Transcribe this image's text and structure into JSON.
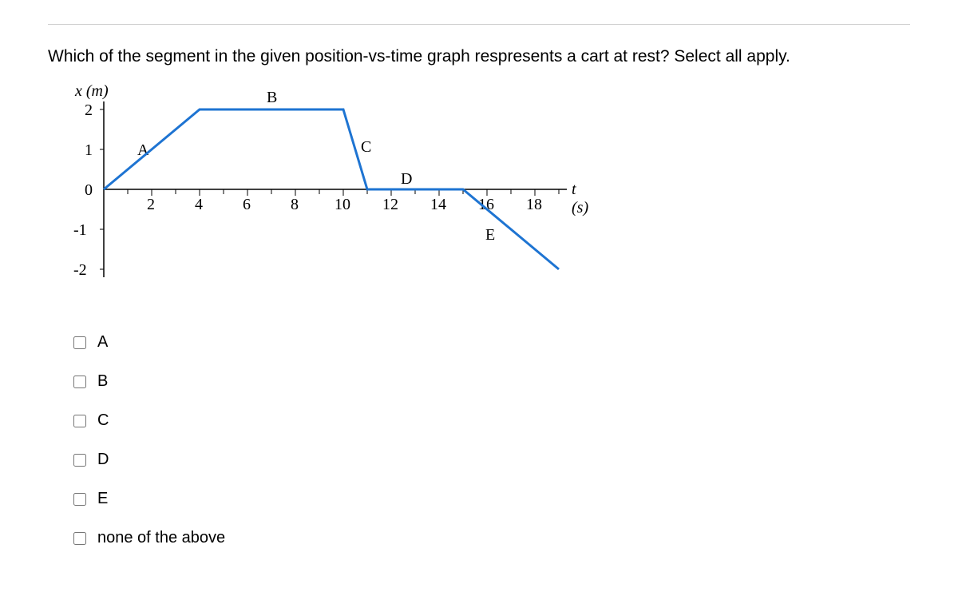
{
  "question": "Which of the segment in the given position-vs-time graph respresents a cart at rest? Select all apply.",
  "chart_data": {
    "type": "line",
    "xlabel": "t (s)",
    "ylabel": "x (m)",
    "xlim": [
      0,
      20
    ],
    "ylim": [
      -2,
      2
    ],
    "x_ticks": [
      2,
      4,
      6,
      8,
      10,
      12,
      14,
      16,
      18
    ],
    "y_ticks": [
      -2,
      -1,
      0,
      1,
      2
    ],
    "segments": [
      {
        "name": "A",
        "points": [
          [
            0,
            0
          ],
          [
            4,
            2
          ]
        ]
      },
      {
        "name": "B",
        "points": [
          [
            4,
            2
          ],
          [
            10,
            2
          ]
        ]
      },
      {
        "name": "C",
        "points": [
          [
            10,
            2
          ],
          [
            11,
            0
          ]
        ]
      },
      {
        "name": "D",
        "points": [
          [
            11,
            0
          ],
          [
            15,
            0
          ]
        ]
      },
      {
        "name": "E",
        "points": [
          [
            15,
            0
          ],
          [
            19,
            -2
          ]
        ]
      }
    ],
    "segment_labels": {
      "A": "A",
      "B": "B",
      "C": "C",
      "D": "D",
      "E": "E"
    }
  },
  "choices": [
    {
      "key": "A",
      "label": "A"
    },
    {
      "key": "B",
      "label": "B"
    },
    {
      "key": "C",
      "label": "C"
    },
    {
      "key": "D",
      "label": "D"
    },
    {
      "key": "E",
      "label": "E"
    },
    {
      "key": "none",
      "label": "none of the above"
    }
  ]
}
